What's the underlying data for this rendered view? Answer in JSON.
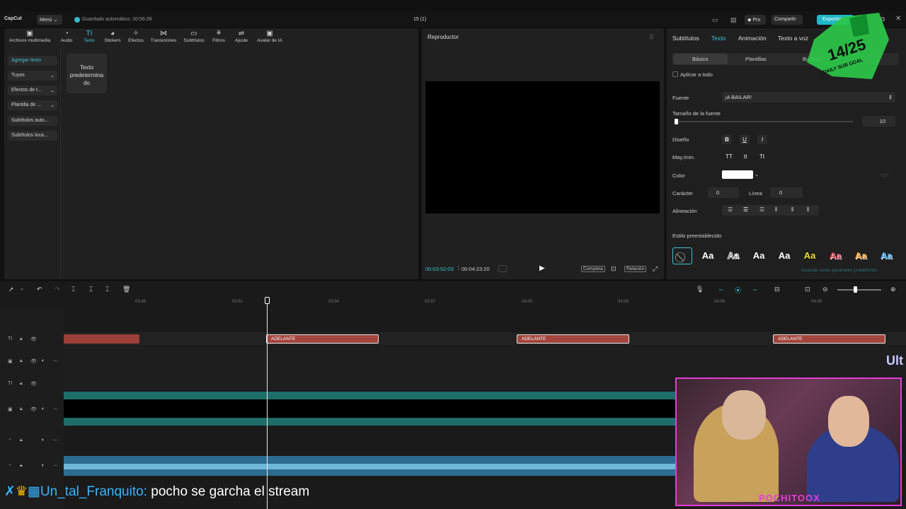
{
  "app": {
    "logo": "CapCut",
    "menu_label": "Menú",
    "autosave": "Guardado automático: 20:56:39",
    "project_title": "15 (1)",
    "pro_label": "Pro",
    "share_label": "Compartir",
    "export_label": "Exportar"
  },
  "toolbar": {
    "items": [
      {
        "label": "Archivos multimedia",
        "icon": "media-icon"
      },
      {
        "label": "Audio",
        "icon": "audio-icon"
      },
      {
        "label": "Texto",
        "icon": "text-icon"
      },
      {
        "label": "Stickers",
        "icon": "sticker-icon"
      },
      {
        "label": "Efectos",
        "icon": "effects-icon"
      },
      {
        "label": "Transiciones",
        "icon": "transition-icon"
      },
      {
        "label": "Subtítulos",
        "icon": "subtitles-icon"
      },
      {
        "label": "Filtros",
        "icon": "filter-icon"
      },
      {
        "label": "Ajuste",
        "icon": "adjust-icon"
      },
      {
        "label": "Avatar de IA",
        "icon": "avatar-icon"
      }
    ]
  },
  "sidebar": {
    "items": [
      {
        "label": "Agregar texto"
      },
      {
        "label": "Tuyos"
      },
      {
        "label": "Efectos de t..."
      },
      {
        "label": "Plantilla de ..."
      },
      {
        "label": "Subtítulos auto..."
      },
      {
        "label": "Subtítulos loca..."
      }
    ]
  },
  "library": {
    "default_text": "Texto predetermina do"
  },
  "player": {
    "title": "Reproductor",
    "current_time": "00:03:52:03",
    "total_time": "00:04:23:20",
    "full_label": "Completa",
    "ratio_label": "Relación"
  },
  "properties": {
    "tabs": [
      "Subtítulos",
      "Texto",
      "Animación",
      "Texto a voz"
    ],
    "subtabs": [
      "Básico",
      "Plantillas",
      "Burbuja"
    ],
    "apply_all": "Aplicar a todo",
    "font_label": "Fuente",
    "font_value": "¡A BAILAR!",
    "size_label": "Tamaño de la fuente",
    "size_value": "10",
    "design_label": "Diseño",
    "case_label": "May./min.",
    "case_options": [
      "TT",
      "tt",
      "Tt"
    ],
    "color_label": "Color",
    "char_label": "Carácter",
    "char_value": "0",
    "line_label": "Línea",
    "line_value": "0",
    "align_label": "Alineación",
    "preset_label": "Estilo preestablecido",
    "save_preset": "Guardar como parámetro predefinido",
    "preset_sample": "Aa"
  },
  "timeline": {
    "ticks": [
      "03:48",
      "03:51",
      "03:54",
      "03:57",
      "04:00",
      "04:03",
      "04:06",
      "04:09"
    ],
    "clips": [
      {
        "label": "ADELANTE"
      },
      {
        "label": "ADELANTE"
      },
      {
        "label": "ADELANTE"
      }
    ]
  },
  "overlay": {
    "chat_user": "Un_tal_Franquito:",
    "chat_message": "pocho se garcha el stream",
    "goal_text": "14/25",
    "goal_sub": "DAILY SUB GOAL",
    "cam_tag": "POCHITOOX",
    "side_text": "Ult"
  }
}
